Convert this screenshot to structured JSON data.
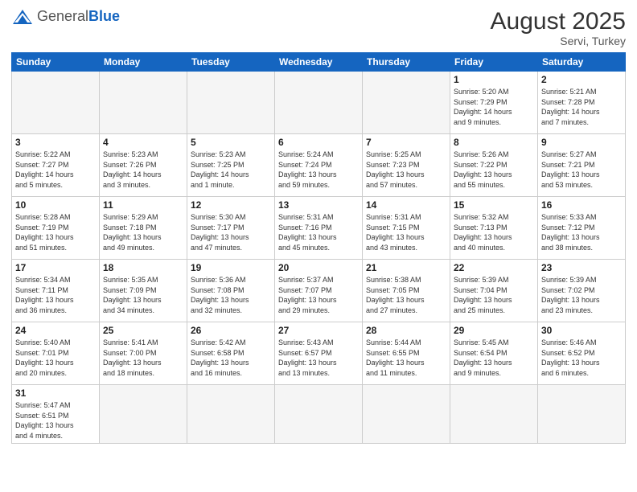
{
  "header": {
    "logo_general": "General",
    "logo_blue": "Blue",
    "month_year": "August 2025",
    "location": "Servi, Turkey"
  },
  "weekdays": [
    "Sunday",
    "Monday",
    "Tuesday",
    "Wednesday",
    "Thursday",
    "Friday",
    "Saturday"
  ],
  "weeks": [
    [
      {
        "day": "",
        "info": ""
      },
      {
        "day": "",
        "info": ""
      },
      {
        "day": "",
        "info": ""
      },
      {
        "day": "",
        "info": ""
      },
      {
        "day": "",
        "info": ""
      },
      {
        "day": "1",
        "info": "Sunrise: 5:20 AM\nSunset: 7:29 PM\nDaylight: 14 hours\nand 9 minutes."
      },
      {
        "day": "2",
        "info": "Sunrise: 5:21 AM\nSunset: 7:28 PM\nDaylight: 14 hours\nand 7 minutes."
      }
    ],
    [
      {
        "day": "3",
        "info": "Sunrise: 5:22 AM\nSunset: 7:27 PM\nDaylight: 14 hours\nand 5 minutes."
      },
      {
        "day": "4",
        "info": "Sunrise: 5:23 AM\nSunset: 7:26 PM\nDaylight: 14 hours\nand 3 minutes."
      },
      {
        "day": "5",
        "info": "Sunrise: 5:23 AM\nSunset: 7:25 PM\nDaylight: 14 hours\nand 1 minute."
      },
      {
        "day": "6",
        "info": "Sunrise: 5:24 AM\nSunset: 7:24 PM\nDaylight: 13 hours\nand 59 minutes."
      },
      {
        "day": "7",
        "info": "Sunrise: 5:25 AM\nSunset: 7:23 PM\nDaylight: 13 hours\nand 57 minutes."
      },
      {
        "day": "8",
        "info": "Sunrise: 5:26 AM\nSunset: 7:22 PM\nDaylight: 13 hours\nand 55 minutes."
      },
      {
        "day": "9",
        "info": "Sunrise: 5:27 AM\nSunset: 7:21 PM\nDaylight: 13 hours\nand 53 minutes."
      }
    ],
    [
      {
        "day": "10",
        "info": "Sunrise: 5:28 AM\nSunset: 7:19 PM\nDaylight: 13 hours\nand 51 minutes."
      },
      {
        "day": "11",
        "info": "Sunrise: 5:29 AM\nSunset: 7:18 PM\nDaylight: 13 hours\nand 49 minutes."
      },
      {
        "day": "12",
        "info": "Sunrise: 5:30 AM\nSunset: 7:17 PM\nDaylight: 13 hours\nand 47 minutes."
      },
      {
        "day": "13",
        "info": "Sunrise: 5:31 AM\nSunset: 7:16 PM\nDaylight: 13 hours\nand 45 minutes."
      },
      {
        "day": "14",
        "info": "Sunrise: 5:31 AM\nSunset: 7:15 PM\nDaylight: 13 hours\nand 43 minutes."
      },
      {
        "day": "15",
        "info": "Sunrise: 5:32 AM\nSunset: 7:13 PM\nDaylight: 13 hours\nand 40 minutes."
      },
      {
        "day": "16",
        "info": "Sunrise: 5:33 AM\nSunset: 7:12 PM\nDaylight: 13 hours\nand 38 minutes."
      }
    ],
    [
      {
        "day": "17",
        "info": "Sunrise: 5:34 AM\nSunset: 7:11 PM\nDaylight: 13 hours\nand 36 minutes."
      },
      {
        "day": "18",
        "info": "Sunrise: 5:35 AM\nSunset: 7:09 PM\nDaylight: 13 hours\nand 34 minutes."
      },
      {
        "day": "19",
        "info": "Sunrise: 5:36 AM\nSunset: 7:08 PM\nDaylight: 13 hours\nand 32 minutes."
      },
      {
        "day": "20",
        "info": "Sunrise: 5:37 AM\nSunset: 7:07 PM\nDaylight: 13 hours\nand 29 minutes."
      },
      {
        "day": "21",
        "info": "Sunrise: 5:38 AM\nSunset: 7:05 PM\nDaylight: 13 hours\nand 27 minutes."
      },
      {
        "day": "22",
        "info": "Sunrise: 5:39 AM\nSunset: 7:04 PM\nDaylight: 13 hours\nand 25 minutes."
      },
      {
        "day": "23",
        "info": "Sunrise: 5:39 AM\nSunset: 7:02 PM\nDaylight: 13 hours\nand 23 minutes."
      }
    ],
    [
      {
        "day": "24",
        "info": "Sunrise: 5:40 AM\nSunset: 7:01 PM\nDaylight: 13 hours\nand 20 minutes."
      },
      {
        "day": "25",
        "info": "Sunrise: 5:41 AM\nSunset: 7:00 PM\nDaylight: 13 hours\nand 18 minutes."
      },
      {
        "day": "26",
        "info": "Sunrise: 5:42 AM\nSunset: 6:58 PM\nDaylight: 13 hours\nand 16 minutes."
      },
      {
        "day": "27",
        "info": "Sunrise: 5:43 AM\nSunset: 6:57 PM\nDaylight: 13 hours\nand 13 minutes."
      },
      {
        "day": "28",
        "info": "Sunrise: 5:44 AM\nSunset: 6:55 PM\nDaylight: 13 hours\nand 11 minutes."
      },
      {
        "day": "29",
        "info": "Sunrise: 5:45 AM\nSunset: 6:54 PM\nDaylight: 13 hours\nand 9 minutes."
      },
      {
        "day": "30",
        "info": "Sunrise: 5:46 AM\nSunset: 6:52 PM\nDaylight: 13 hours\nand 6 minutes."
      }
    ],
    [
      {
        "day": "31",
        "info": "Sunrise: 5:47 AM\nSunset: 6:51 PM\nDaylight: 13 hours\nand 4 minutes."
      },
      {
        "day": "",
        "info": ""
      },
      {
        "day": "",
        "info": ""
      },
      {
        "day": "",
        "info": ""
      },
      {
        "day": "",
        "info": ""
      },
      {
        "day": "",
        "info": ""
      },
      {
        "day": "",
        "info": ""
      }
    ]
  ]
}
